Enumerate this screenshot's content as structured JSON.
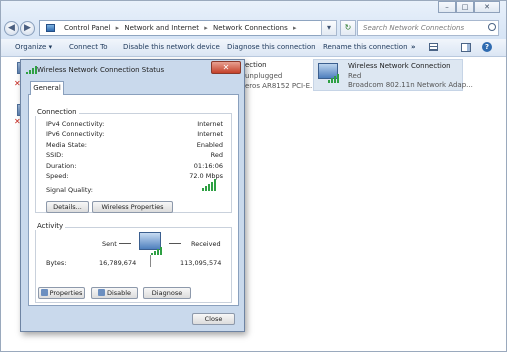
{
  "window": {
    "controls": {
      "minimize": "–",
      "maximize": "□",
      "close": "✕"
    },
    "nav": {
      "back": "◀",
      "forward": "▶"
    },
    "breadcrumb": [
      "Control Panel",
      "Network and Internet",
      "Network Connections"
    ],
    "sep": "▸",
    "search_placeholder": "Search Network Connections",
    "refresh": "↻",
    "dropdown": "▾"
  },
  "toolbar": {
    "organize": "Organize ▾",
    "connect": "Connect To",
    "disable": "Disable this network device",
    "diagnose": "Diagnose this connection",
    "rename": "Rename this connection",
    "more": "»"
  },
  "connections": {
    "partial_name": "ection",
    "partial_status": "unplugged",
    "partial_adapter": "eros AR8152 PCI-E...",
    "wireless_name": "Wireless Network Connection",
    "wireless_status": "Red",
    "wireless_adapter": "Broadcom 802.11n Network Adap..."
  },
  "dialog": {
    "title": "Wireless Network Connection Status",
    "close": "✕",
    "tab": "General",
    "connection_group": "Connection",
    "rows": [
      {
        "label": "IPv4 Connectivity:",
        "value": "Internet"
      },
      {
        "label": "IPv6 Connectivity:",
        "value": "Internet"
      },
      {
        "label": "Media State:",
        "value": "Enabled"
      },
      {
        "label": "SSID:",
        "value": "Red"
      },
      {
        "label": "Duration:",
        "value": "01:16:06"
      },
      {
        "label": "Speed:",
        "value": "72.0 Mbps"
      }
    ],
    "signal_label": "Signal Quality:",
    "details_btn": "Details...",
    "wireless_props_btn": "Wireless Properties",
    "activity_group": "Activity",
    "sent_label": "Sent",
    "received_label": "Received",
    "bytes_label": "Bytes:",
    "bytes_sent": "16,789,674",
    "bytes_received": "113,095,574",
    "properties_btn": "Properties",
    "disable_btn": "Disable",
    "diagnose_btn": "Diagnose",
    "close_btn": "Close"
  },
  "colors": {
    "accent": "#1e395b",
    "signal": "#2ea043",
    "close_red": "#c4412a"
  }
}
